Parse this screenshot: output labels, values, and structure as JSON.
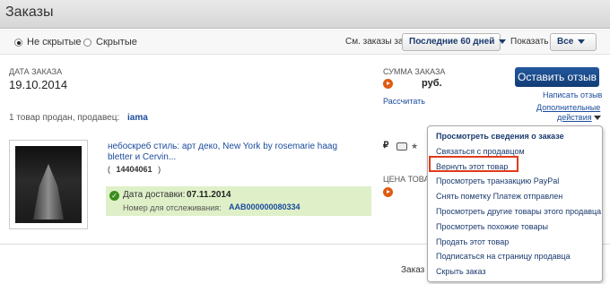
{
  "page_title": "Заказы",
  "filter": {
    "radio_not_hidden": "Не скрытые",
    "radio_hidden": "Скрытые",
    "view_label": "См. заказы за",
    "period_value": "Последние 60 дней",
    "show_label": "Показать",
    "show_value": "Все"
  },
  "order": {
    "date_label": "ДАТА ЗАКАЗА",
    "date_value": "19.10.2014",
    "sum_label": "СУММА ЗАКАЗА",
    "sum_currency": "руб.",
    "calc_link": "Рассчитать",
    "leave_feedback": "Оставить отзыв",
    "write_feedback": "Написать отзыв",
    "more_actions_line1": "Дополнительные",
    "more_actions_line2": "действия",
    "sold_by_text": "1 товар продан, продавец:",
    "seller_name": "iama"
  },
  "item": {
    "title_line1": "небоскреб стиль: арт деко, New York by rosemarie haag",
    "title_line2": "bletter и Cervin...",
    "item_id": "14404061",
    "price_symbol": "₽",
    "price_label": "ЦЕНА ТОВА",
    "delivery_label": "Дата доставки:",
    "delivery_date": "07.11.2014",
    "tracking_label": "Номер для отслеживания:",
    "tracking_number": "AAB000000080334"
  },
  "menu": {
    "items": [
      "Просмотреть сведения о заказе",
      "Связаться с продавцом",
      "Вернуть этот товар",
      "Просмотреть транзакцию PayPal",
      "Снять пометку Платеж отправлен",
      "Просмотреть другие товары этого продавца",
      "Просмотреть похожие товары",
      "Продать этот товар",
      "Подписаться на страницу продавца",
      "Скрыть заказ"
    ]
  },
  "footer": {
    "partial_text": "Заказ"
  },
  "colors": {
    "accent": "#1a3a6e",
    "highlight_border": "#e13a1a",
    "delivery_bg": "#dff0c8",
    "orange": "#e05a12"
  }
}
